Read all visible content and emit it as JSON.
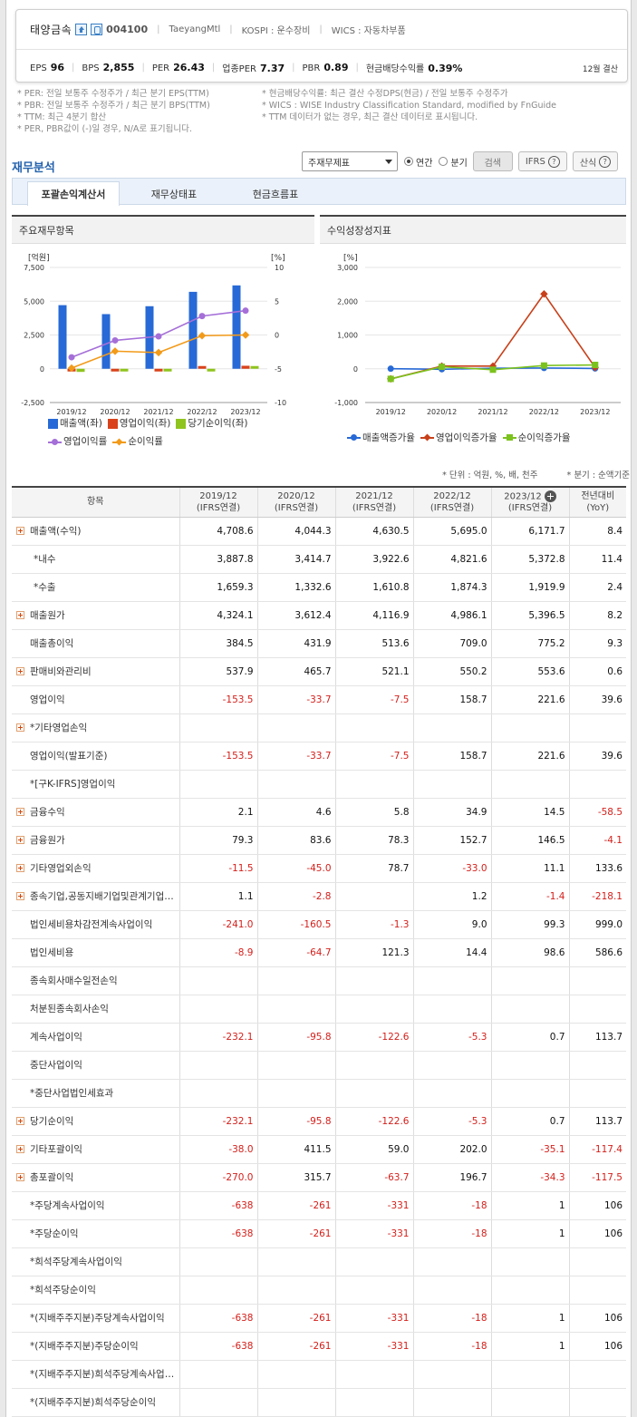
{
  "company": {
    "name": "태양금속",
    "code": "004100",
    "eng_name": "TaeyangMtl",
    "market": "KOSPI : 운수장비",
    "wics": "WICS : 자동차부품"
  },
  "indicators": [
    {
      "label": "EPS",
      "value": "96"
    },
    {
      "label": "BPS",
      "value": "2,855"
    },
    {
      "label": "PER",
      "value": "26.43"
    },
    {
      "label": "업종PER",
      "value": "7.37"
    },
    {
      "label": "PBR",
      "value": "0.89"
    },
    {
      "label": "현금배당수익률",
      "value": "0.39%"
    }
  ],
  "fiscal_year_end": "12월 결산",
  "notes": {
    "left": [
      "* PER: 전일 보통주 수정주가 / 최근 분기 EPS(TTM)",
      "* PBR: 전일 보통주 수정주가 / 최근 분기 BPS(TTM)",
      "* TTM: 최근 4분기 합산",
      "* PER, PBR값이 (-)일 경우, N/A로 표기됩니다."
    ],
    "right": [
      "* 현금배당수익률: 최근 결산 수정DPS(현금) / 전일 보통주 수정주가",
      "* WICS : WISE Industry Classification Standard, modified by FnGuide",
      "* TTM 데이터가 없는 경우, 최근 결산 데이터로 표시됩니다."
    ]
  },
  "section_title": "재무분석",
  "controls": {
    "select_value": "주재무제표",
    "radio_annual": "연간",
    "radio_quarter": "분기",
    "search": "검색",
    "ifrs": "IFRS",
    "formula": "산식",
    "q": "?"
  },
  "tabs": [
    "포괄손익계산서",
    "재무상태표",
    "현금흐름표"
  ],
  "panels": {
    "left_title": "주요재무항목",
    "right_title": "수익성장성지표"
  },
  "chart_data": [
    {
      "type": "bar",
      "categories": [
        "2019/12",
        "2020/12",
        "2021/12",
        "2022/12",
        "2023/12"
      ],
      "y_left_label": "[억원]",
      "y_right_label": "[%]",
      "ylim": [
        -2500,
        7500
      ],
      "ylim_right": [
        -10,
        10
      ],
      "y_ticks": [
        "7,500",
        "5,000",
        "2,500",
        "0",
        "-2,500"
      ],
      "y_right_ticks": [
        "10",
        "5",
        "0",
        "-5",
        "-10"
      ],
      "series": [
        {
          "name": "매출액(좌)",
          "kind": "bar",
          "axis": "left",
          "color": "#2769d6",
          "values": [
            4708.6,
            4044.3,
            4630.5,
            5695.0,
            6171.7
          ]
        },
        {
          "name": "영업이익(좌)",
          "kind": "bar",
          "axis": "left",
          "color": "#d9421a",
          "values": [
            -153.5,
            -33.7,
            -7.5,
            158.7,
            221.6
          ]
        },
        {
          "name": "당기순이익(좌)",
          "kind": "bar",
          "axis": "left",
          "color": "#8fc41e",
          "values": [
            -232.1,
            -95.8,
            -122.6,
            -5.3,
            0.7
          ]
        },
        {
          "name": "영업이익률",
          "kind": "line",
          "axis": "right",
          "marker": "circle",
          "color": "#a56fd8",
          "values": [
            -3.3,
            -0.8,
            -0.2,
            2.8,
            3.6
          ]
        },
        {
          "name": "순이익률",
          "kind": "line",
          "axis": "right",
          "marker": "diamond",
          "color": "#f29a19",
          "values": [
            -4.9,
            -2.4,
            -2.6,
            -0.1,
            0.0
          ]
        }
      ]
    },
    {
      "type": "line",
      "categories": [
        "2019/12",
        "2020/12",
        "2021/12",
        "2022/12",
        "2023/12"
      ],
      "y_left_label": "[%]",
      "ylim": [
        -1000,
        3000
      ],
      "y_ticks": [
        "3,000",
        "2,000",
        "1,000",
        "0",
        "-1,000"
      ],
      "series": [
        {
          "name": "매출액증가율",
          "marker": "circle",
          "color": "#2769d6",
          "values": [
            2.0,
            -14.1,
            14.5,
            23.0,
            8.4
          ]
        },
        {
          "name": "영업이익증가율",
          "marker": "diamond",
          "color": "#c7401a",
          "values": [
            -300,
            78.0,
            77.7,
            2216,
            39.6
          ]
        },
        {
          "name": "순이익증가율",
          "marker": "square",
          "color": "#7cc21e",
          "values": [
            -300,
            58.7,
            -28.0,
            95.7,
            113.7
          ]
        }
      ]
    }
  ],
  "units_note": "* 단위 : 억원, %, 배, 천주",
  "units_note2": "* 분기 : 순액기준",
  "table": {
    "header_item": "항목",
    "columns": [
      {
        "year": "2019/12",
        "basis": "(IFRS연결)"
      },
      {
        "year": "2020/12",
        "basis": "(IFRS연결)"
      },
      {
        "year": "2021/12",
        "basis": "(IFRS연결)"
      },
      {
        "year": "2022/12",
        "basis": "(IFRS연결)"
      },
      {
        "year": "2023/12",
        "basis": "(IFRS연결)"
      }
    ],
    "yoy_header": "전년대비",
    "yoy_sub": "(YoY)",
    "rows": [
      {
        "label": "매출액(수익)",
        "expand": true,
        "values": [
          "4,708.6",
          "4,044.3",
          "4,630.5",
          "5,695.0",
          "6,171.7",
          "8.4"
        ]
      },
      {
        "label": "*내수",
        "expand": false,
        "indent": true,
        "values": [
          "3,887.8",
          "3,414.7",
          "3,922.6",
          "4,821.6",
          "5,372.8",
          "11.4"
        ]
      },
      {
        "label": "*수출",
        "expand": false,
        "indent": true,
        "values": [
          "1,659.3",
          "1,332.6",
          "1,610.8",
          "1,874.3",
          "1,919.9",
          "2.4"
        ]
      },
      {
        "label": "매출원가",
        "expand": true,
        "values": [
          "4,324.1",
          "3,612.4",
          "4,116.9",
          "4,986.1",
          "5,396.5",
          "8.2"
        ]
      },
      {
        "label": "매출총이익",
        "expand": false,
        "values": [
          "384.5",
          "431.9",
          "513.6",
          "709.0",
          "775.2",
          "9.3"
        ]
      },
      {
        "label": "판매비와관리비",
        "expand": true,
        "values": [
          "537.9",
          "465.7",
          "521.1",
          "550.2",
          "553.6",
          "0.6"
        ]
      },
      {
        "label": "영업이익",
        "expand": false,
        "values": [
          "-153.5",
          "-33.7",
          "-7.5",
          "158.7",
          "221.6",
          "39.6"
        ]
      },
      {
        "label": "*기타영업손익",
        "expand": true,
        "values": [
          "",
          "",
          "",
          "",
          "",
          ""
        ]
      },
      {
        "label": "영업이익(발표기준)",
        "expand": false,
        "values": [
          "-153.5",
          "-33.7",
          "-7.5",
          "158.7",
          "221.6",
          "39.6"
        ]
      },
      {
        "label": "*[구K-IFRS]영업이익",
        "expand": false,
        "values": [
          "",
          "",
          "",
          "",
          "",
          ""
        ]
      },
      {
        "label": "금융수익",
        "expand": true,
        "values": [
          "2.1",
          "4.6",
          "5.8",
          "34.9",
          "14.5",
          "-58.5"
        ]
      },
      {
        "label": "금융원가",
        "expand": true,
        "values": [
          "79.3",
          "83.6",
          "78.3",
          "152.7",
          "146.5",
          "-4.1"
        ]
      },
      {
        "label": "기타영업외손익",
        "expand": true,
        "values": [
          "-11.5",
          "-45.0",
          "78.7",
          "-33.0",
          "11.1",
          "133.6"
        ]
      },
      {
        "label": "종속기업,공동지배기업및관계기업관련손익",
        "expand": true,
        "values": [
          "1.1",
          "-2.8",
          "",
          "1.2",
          "-1.4",
          "-218.1"
        ]
      },
      {
        "label": "법인세비용차감전계속사업이익",
        "expand": false,
        "values": [
          "-241.0",
          "-160.5",
          "-1.3",
          "9.0",
          "99.3",
          "999.0"
        ]
      },
      {
        "label": "법인세비용",
        "expand": false,
        "values": [
          "-8.9",
          "-64.7",
          "121.3",
          "14.4",
          "98.6",
          "586.6"
        ]
      },
      {
        "label": "종속회사매수일전손익",
        "expand": false,
        "values": [
          "",
          "",
          "",
          "",
          "",
          ""
        ]
      },
      {
        "label": "처분된종속회사손익",
        "expand": false,
        "values": [
          "",
          "",
          "",
          "",
          "",
          ""
        ]
      },
      {
        "label": "계속사업이익",
        "expand": false,
        "values": [
          "-232.1",
          "-95.8",
          "-122.6",
          "-5.3",
          "0.7",
          "113.7"
        ]
      },
      {
        "label": "중단사업이익",
        "expand": false,
        "values": [
          "",
          "",
          "",
          "",
          "",
          ""
        ]
      },
      {
        "label": "*중단사업법인세효과",
        "expand": false,
        "values": [
          "",
          "",
          "",
          "",
          "",
          ""
        ]
      },
      {
        "label": "당기순이익",
        "expand": true,
        "values": [
          "-232.1",
          "-95.8",
          "-122.6",
          "-5.3",
          "0.7",
          "113.7"
        ]
      },
      {
        "label": "기타포괄이익",
        "expand": true,
        "values": [
          "-38.0",
          "411.5",
          "59.0",
          "202.0",
          "-35.1",
          "-117.4"
        ]
      },
      {
        "label": "총포괄이익",
        "expand": true,
        "values": [
          "-270.0",
          "315.7",
          "-63.7",
          "196.7",
          "-34.3",
          "-117.5"
        ]
      },
      {
        "label": "*주당계속사업이익",
        "expand": false,
        "values": [
          "-638",
          "-261",
          "-331",
          "-18",
          "1",
          "106"
        ]
      },
      {
        "label": "*주당순이익",
        "expand": false,
        "values": [
          "-638",
          "-261",
          "-331",
          "-18",
          "1",
          "106"
        ]
      },
      {
        "label": "*희석주당계속사업이익",
        "expand": false,
        "values": [
          "",
          "",
          "",
          "",
          "",
          ""
        ]
      },
      {
        "label": "*희석주당순이익",
        "expand": false,
        "values": [
          "",
          "",
          "",
          "",
          "",
          ""
        ]
      },
      {
        "label": "*(지배주주지분)주당계속사업이익",
        "expand": false,
        "values": [
          "-638",
          "-261",
          "-331",
          "-18",
          "1",
          "106"
        ]
      },
      {
        "label": "*(지배주주지분)주당순이익",
        "expand": false,
        "values": [
          "-638",
          "-261",
          "-331",
          "-18",
          "1",
          "106"
        ]
      },
      {
        "label": "*(지배주주지분)희석주당계속사업이익",
        "expand": false,
        "values": [
          "",
          "",
          "",
          "",
          "",
          ""
        ]
      },
      {
        "label": "*(지배주주지분)희석주당순이익",
        "expand": false,
        "values": [
          "",
          "",
          "",
          "",
          "",
          ""
        ]
      }
    ]
  },
  "colors": {
    "accent": "#2462ad",
    "negative": "#d4201b"
  }
}
